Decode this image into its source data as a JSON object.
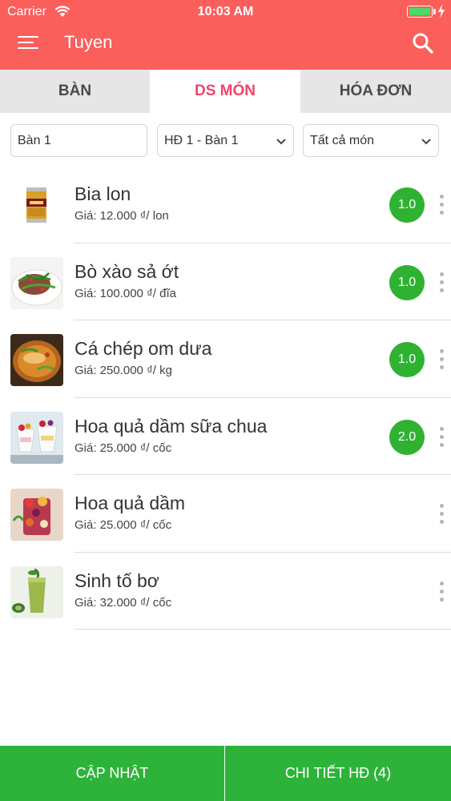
{
  "status_bar": {
    "carrier": "Carrier",
    "time": "10:03 AM"
  },
  "nav": {
    "title": "Tuyen",
    "menu_icon": "menu-icon",
    "search_icon": "search-icon"
  },
  "tabs": [
    {
      "label": "BÀN",
      "active": false
    },
    {
      "label": "DS MÓN",
      "active": true
    },
    {
      "label": "HÓA ĐƠN",
      "active": false
    }
  ],
  "filters": {
    "table_value": "Bàn 1",
    "invoice_selected": "HĐ 1 - Bàn 1",
    "category_selected": "Tất cả món"
  },
  "items": [
    {
      "name": "Bia lon",
      "price": "Giá: 12.000 ₫/ lon",
      "qty": "1.0"
    },
    {
      "name": "Bò xào sả ớt",
      "price": "Giá: 100.000 ₫/ đĩa",
      "qty": "1.0"
    },
    {
      "name": "Cá chép om dưa",
      "price": "Giá: 250.000 ₫/ kg",
      "qty": "1.0"
    },
    {
      "name": "Hoa quả dầm sữa chua",
      "price": "Giá: 25.000 ₫/ cốc",
      "qty": "2.0"
    },
    {
      "name": "Hoa quả dầm",
      "price": "Giá: 25.000 ₫/ cốc",
      "qty": ""
    },
    {
      "name": "Sinh tố bơ",
      "price": "Giá: 32.000 ₫/ cốc",
      "qty": ""
    }
  ],
  "footer": {
    "update_label": "CẬP NHẬT",
    "detail_label": "CHI TIẾT HĐ (4)"
  },
  "colors": {
    "header": "#fa5f5b",
    "active_tab": "#f0456a",
    "qty_badge": "#2fb232",
    "footer": "#2eb33a"
  }
}
